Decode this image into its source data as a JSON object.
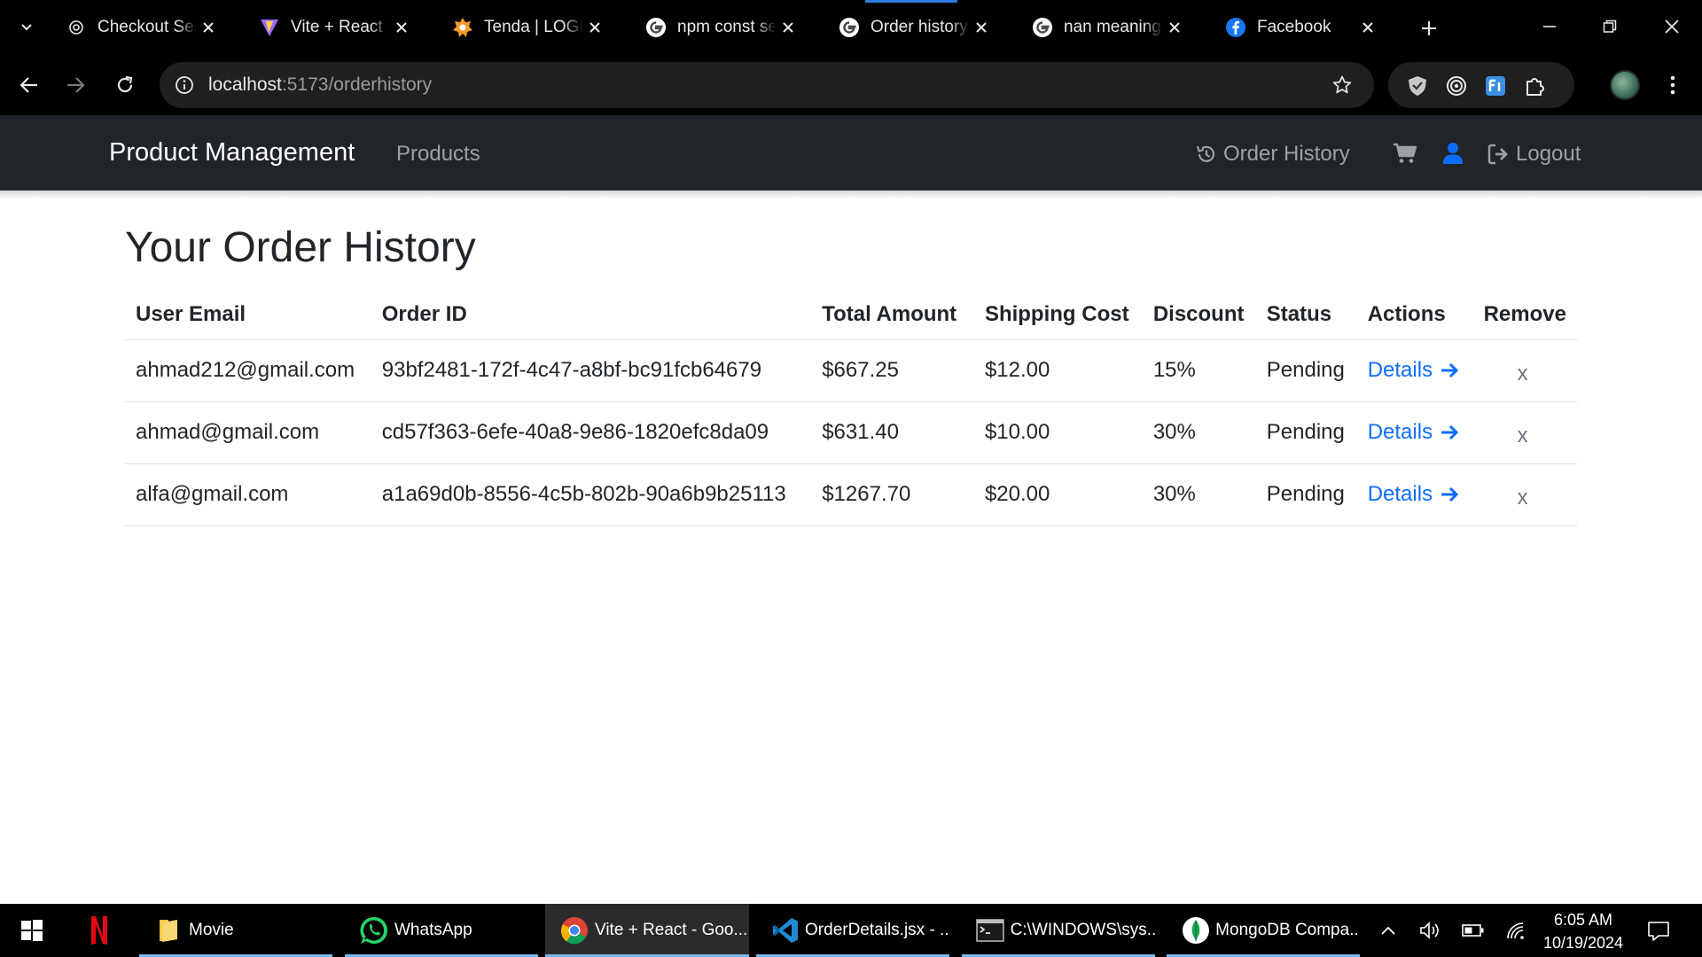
{
  "browser": {
    "tabs": [
      {
        "title": "Checkout Sess",
        "icon": "openai-icon"
      },
      {
        "title": "Vite + React",
        "icon": "vite-icon"
      },
      {
        "title": "Tenda | LOGIN",
        "icon": "tenda-icon"
      },
      {
        "title": "npm const ses",
        "icon": "google-icon"
      },
      {
        "title": "Order history",
        "icon": "google-icon",
        "active": true
      },
      {
        "title": "nan meaning i",
        "icon": "google-icon"
      },
      {
        "title": "Facebook",
        "icon": "facebook-icon"
      }
    ],
    "url_host": "localhost",
    "url_path": ":5173/orderhistory"
  },
  "navbar": {
    "brand": "Product Management",
    "products": "Products",
    "order_history": "Order History",
    "logout": "Logout"
  },
  "page": {
    "title": "Your Order History"
  },
  "table": {
    "headers": [
      "User Email",
      "Order ID",
      "Total Amount",
      "Shipping Cost",
      "Discount",
      "Status",
      "Actions",
      "Remove"
    ],
    "rows": [
      {
        "email": "ahmad212@gmail.com",
        "order_id": "93bf2481-172f-4c47-a8bf-bc91fcb64679",
        "total": "$667.25",
        "shipping": "$12.00",
        "discount": "15%",
        "status": "Pending",
        "action": "Details",
        "remove": "x"
      },
      {
        "email": "ahmad@gmail.com",
        "order_id": "cd57f363-6efe-40a8-9e86-1820efc8da09",
        "total": "$631.40",
        "shipping": "$10.00",
        "discount": "30%",
        "status": "Pending",
        "action": "Details",
        "remove": "x"
      },
      {
        "email": "alfa@gmail.com",
        "order_id": "a1a69d0b-8556-4c5b-802b-90a6b9b25113",
        "total": "$1267.70",
        "shipping": "$20.00",
        "discount": "30%",
        "status": "Pending",
        "action": "Details",
        "remove": "x"
      }
    ]
  },
  "taskbar": {
    "apps": [
      {
        "label": "Movie",
        "icon": "folder-icon"
      },
      {
        "label": "WhatsApp",
        "icon": "whatsapp-icon"
      },
      {
        "label": "Vite + React - Goo...",
        "icon": "chrome-icon",
        "active": true
      },
      {
        "label": "OrderDetails.jsx - ...",
        "icon": "vscode-icon"
      },
      {
        "label": "C:\\WINDOWS\\sys...",
        "icon": "terminal-icon"
      },
      {
        "label": "MongoDB Compa...",
        "icon": "mongodb-icon"
      }
    ],
    "time": "6:05 AM",
    "date": "10/19/2024"
  },
  "colors": {
    "navbar_bg": "#212529",
    "link_blue": "#0d6efd",
    "user_icon_blue": "#0d6efd",
    "browser_bg": "#000000"
  }
}
